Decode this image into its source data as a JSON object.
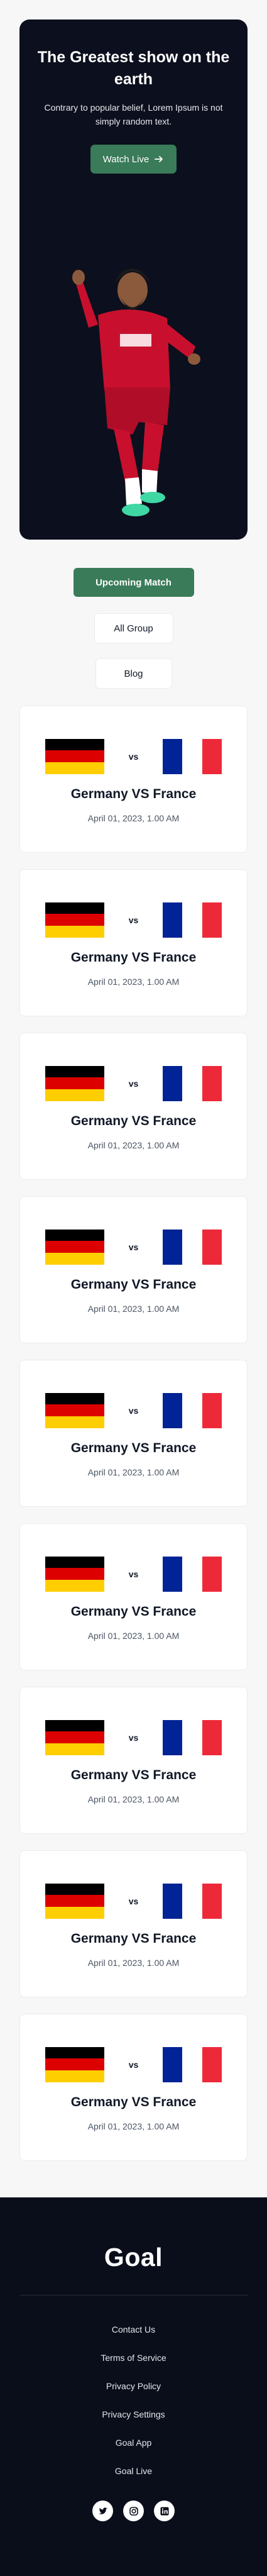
{
  "hero": {
    "title": "The Greatest show on the earth",
    "subtitle": "Contrary to popular belief, Lorem Ipsum is not simply random text.",
    "cta_label": "Watch Live"
  },
  "tabs": [
    {
      "label": "Upcoming Match",
      "active": true
    },
    {
      "label": "All Group",
      "active": false
    },
    {
      "label": "Blog",
      "active": false
    }
  ],
  "matches": [
    {
      "home_flag": "germany-flag",
      "away_flag": "france-flag",
      "vs": "vs",
      "title": "Germany VS France",
      "date": "April 01, 2023, 1.00 AM"
    },
    {
      "home_flag": "germany-flag",
      "away_flag": "france-flag",
      "vs": "vs",
      "title": "Germany VS France",
      "date": "April 01, 2023, 1.00 AM"
    },
    {
      "home_flag": "germany-flag",
      "away_flag": "france-flag",
      "vs": "vs",
      "title": "Germany VS France",
      "date": "April 01, 2023, 1.00 AM"
    },
    {
      "home_flag": "germany-flag",
      "away_flag": "france-flag",
      "vs": "vs",
      "title": "Germany VS France",
      "date": "April 01, 2023, 1.00 AM"
    },
    {
      "home_flag": "germany-flag",
      "away_flag": "france-flag",
      "vs": "vs",
      "title": "Germany VS France",
      "date": "April 01, 2023, 1.00 AM"
    },
    {
      "home_flag": "germany-flag",
      "away_flag": "france-flag",
      "vs": "vs",
      "title": "Germany VS France",
      "date": "April 01, 2023, 1.00 AM"
    },
    {
      "home_flag": "germany-flag",
      "away_flag": "france-flag",
      "vs": "vs",
      "title": "Germany VS France",
      "date": "April 01, 2023, 1.00 AM"
    },
    {
      "home_flag": "germany-flag",
      "away_flag": "france-flag",
      "vs": "vs",
      "title": "Germany VS France",
      "date": "April 01, 2023, 1.00 AM"
    },
    {
      "home_flag": "germany-flag",
      "away_flag": "france-flag",
      "vs": "vs",
      "title": "Germany VS France",
      "date": "April 01, 2023, 1.00 AM"
    }
  ],
  "footer": {
    "logo": "Goal",
    "links": [
      "Contact Us",
      "Terms of Service",
      "Privacy Policy",
      "Privacy Settings",
      "Goal App",
      "Goal Live"
    ],
    "socials": [
      "twitter-icon",
      "instagram-icon",
      "linkedin-icon"
    ]
  },
  "colors": {
    "accent": "#3a7b59",
    "hero_bg": "#0c0f1d",
    "footer_bg": "#0a0e1b",
    "germany": [
      "#000000",
      "#dd0000",
      "#ffce00"
    ],
    "france": [
      "#002395",
      "#ffffff",
      "#ed2939"
    ]
  }
}
